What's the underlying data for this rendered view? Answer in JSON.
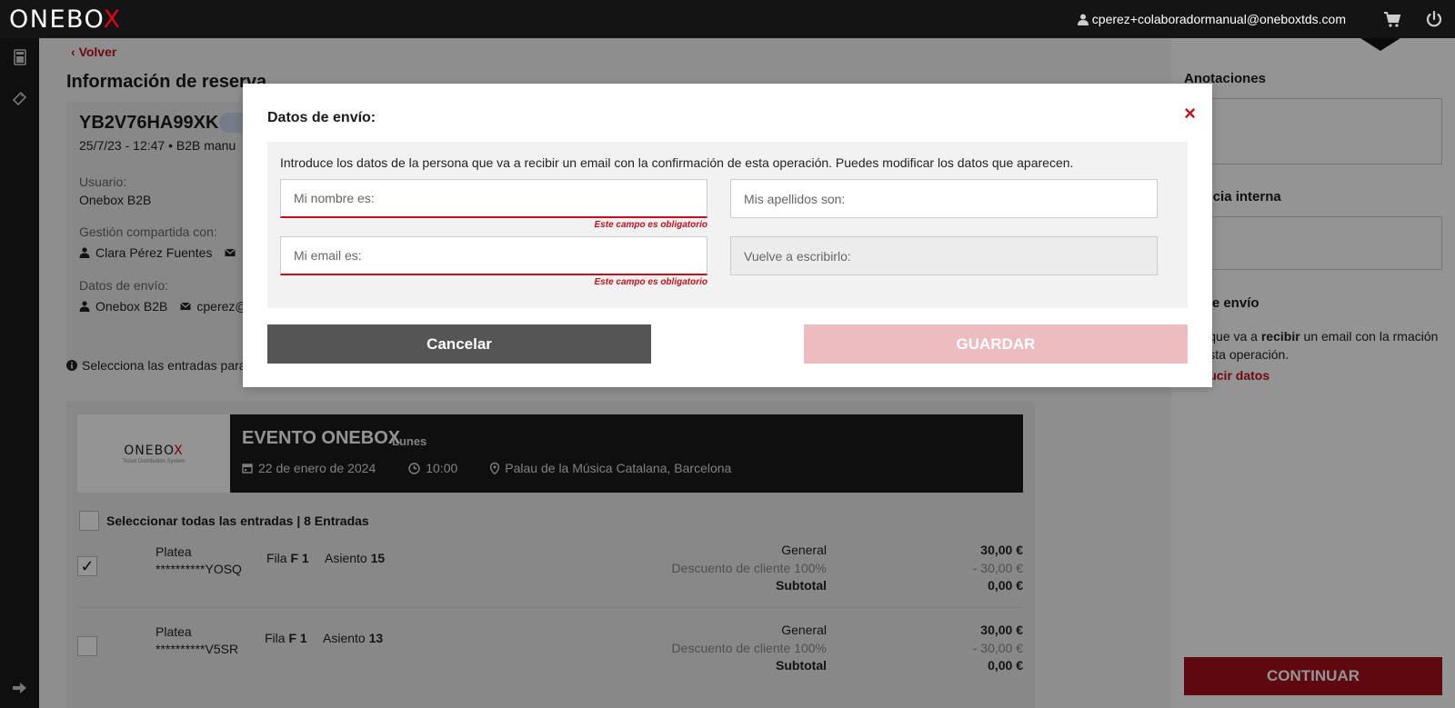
{
  "app": {
    "logo_prefix": "ONEBO",
    "logo_suffix": "X",
    "user_email": "cperez+colaboradormanual@oneboxtds.com"
  },
  "colors": {
    "accent": "#c3111e",
    "topbar": "#141414",
    "continue": "#a0101b",
    "save_disabled": "#ecbcc0"
  },
  "icons": {
    "user": "user-icon",
    "cart": "cart-icon",
    "power": "power-icon",
    "calculator": "calculator-icon",
    "ticket": "ticket-icon",
    "arrow": "arrow-right-icon",
    "calendar": "calendar-icon",
    "clock": "clock-icon",
    "location": "location-pin-icon",
    "mail": "mail-icon",
    "info": "info-icon"
  },
  "main": {
    "back_label": "Volver",
    "page_title": "Información de reserva",
    "booking": {
      "locator": "YB2V76HA99XK",
      "meta": "25/7/23 - 12:47  •  B2B manu",
      "user_label": "Usuario:",
      "user_value": "Onebox B2B",
      "shared_label": "Gestión compartida con:",
      "shared_value": "Clara Pérez Fuentes",
      "shipping_label": "Datos de envío:",
      "shipping_value": "Onebox B2B",
      "shipping_email": "cperez@"
    },
    "hint": "Selecciona las entradas para",
    "event": {
      "logo_prefix": "ONEBO",
      "logo_suffix": "X",
      "logo_sub": "Ticket Distribution System",
      "title": "EVENTO ONEBOX",
      "day": "Lunes",
      "date": "22 de enero de 2024",
      "time": "10:00",
      "venue": "Palau de la Música Catalana, Barcelona"
    },
    "select_all": "Seleccionar todas las entradas | 8 Entradas",
    "tickets": [
      {
        "checked": true,
        "zone": "Platea",
        "code": "**********YOSQ",
        "row_label": "Fila",
        "row": "F 1",
        "seat_label": "Asiento",
        "seat": "15",
        "rate_label": "General",
        "rate_value": "30,00 €",
        "discount_label": "Descuento de cliente 100%",
        "discount_value": "- 30,00 €",
        "subtotal_label": "Subtotal",
        "subtotal_value": "0,00 €"
      },
      {
        "checked": false,
        "zone": "Platea",
        "code": "**********V5SR",
        "row_label": "Fila",
        "row": "F 1",
        "seat_label": "Asiento",
        "seat": "13",
        "rate_label": "General",
        "rate_value": "30,00 €",
        "discount_label": "Descuento de cliente 100%",
        "discount_value": "- 30,00 €",
        "subtotal_label": "Subtotal",
        "subtotal_value": "0,00 €"
      }
    ]
  },
  "right_panel": {
    "annotations_title": "Anotaciones",
    "internal_ref_title": "erencia interna",
    "shipping_title": "os de envío",
    "shipping_text_pre": "ona que va a ",
    "shipping_text_bold": "recibir",
    "shipping_text_post": " un email con la rmación de esta operación.",
    "shipping_link": "troducir datos",
    "continue_label": "CONTINUAR"
  },
  "modal": {
    "title": "Datos de envío:",
    "close_glyph": "×",
    "description": "Introduce los datos de la persona que va a recibir un email con la confirmación de esta operación. Puedes modificar los datos que aparecen.",
    "fields": {
      "name_placeholder": "Mi nombre es:",
      "surname_placeholder": "Mis apellidos son:",
      "email_placeholder": "Mi email es:",
      "email_confirm_placeholder": "Vuelve a escribirlo:"
    },
    "required_error": "Este campo es obligatorio",
    "cancel_label": "Cancelar",
    "save_label": "GUARDAR"
  }
}
